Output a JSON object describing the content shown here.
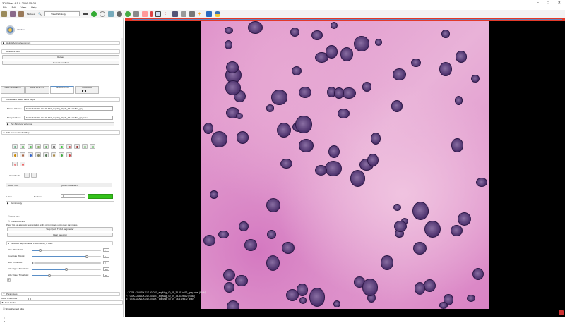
{
  "window": {
    "title": "3D Slicer 4.5.0-2016-05-08"
  },
  "menu": [
    "File",
    "Edit",
    "View",
    "Help"
  ],
  "toolbar": {
    "modules_label": "Modules:",
    "module_selected": "SlicerPathology"
  },
  "logo_text": "3DSlicer",
  "sections": {
    "help": "Help & Acknowledgement",
    "reload": "Reload & Test",
    "create": "Create and Select Label Maps",
    "per_structure": "Per-Structure Volumes",
    "edit": "Edit Selected Label Map",
    "terminology": "Terminology",
    "nucleus_params": "Nucleus Segmentation Parameters (Yi Gao)",
    "parameters": "Parameters",
    "data_probe": "Data Probe"
  },
  "buttons": {
    "reload": "Reload",
    "reload_test": "Reload and Test",
    "run": "Stop Quick TCGA Segmenter",
    "clear": "Clear Selection"
  },
  "tabs": [
    "IMAGE INFORMATION",
    "IMAGE SELECTION",
    "SEGMENTATION",
    "SUBMISSION"
  ],
  "master_volume": {
    "label": "Master Volume:",
    "value": "TCGA-42-A8DX-01Z-00-DX1_appMag_40_29_38-512x512_gray"
  },
  "merge_volume": {
    "label": "Merge Volume:",
    "value": "TCGA-42-A8DX-01Z-00-DX1_appMag_40_29_38-512x512_gray-label"
  },
  "undo_redo_label": "Undo/Redo:",
  "active_tool": {
    "label": "Active Tool:",
    "value": "QuickTCGAEffect"
  },
  "label_row": {
    "label": "Label:",
    "name": "Nucleus",
    "value": "1",
    "color": "#33c21a"
  },
  "paint_over": {
    "label": "Paint Over",
    "checked": true
  },
  "threshold_paint": {
    "label": "Threshold Paint",
    "checked": false
  },
  "hint": "Press Y to run automatic segmentation on the current image using given parameters.",
  "sliders": [
    {
      "label": "Otsu Threshold:",
      "value": "1",
      "fraction": 0.12
    },
    {
      "label": "Curvature Weight:",
      "value": "8",
      "fraction": 0.8
    },
    {
      "label": "Size Threshold:",
      "value": "3",
      "fraction": 0.03
    },
    {
      "label": "Size Upper Threshold:",
      "value": "300",
      "fraction": 0.5
    },
    {
      "label": "Size Upper Threshold:",
      "value": "20",
      "fraction": 0.25
    }
  ],
  "small_btn": "?",
  "enable_screenshots": "Enable Screenshots",
  "show_zoomed": "Show Zoomed Slice",
  "probe_lines": [
    "L",
    "F",
    "B"
  ],
  "overlay": [
    "L: TCGA-42-A8DX-01Z-00-DX1_appMag_40_29_38-512x512_gray-label (NMM)",
    "F: TCGA-42-A8DX-01Z-00-DX1_appMag_40_29_38-512x512 (NMM)",
    "B: TCGA-42-A8DX-01Z-00-DX1_appMag_40_29_38-512x512_gray"
  ]
}
